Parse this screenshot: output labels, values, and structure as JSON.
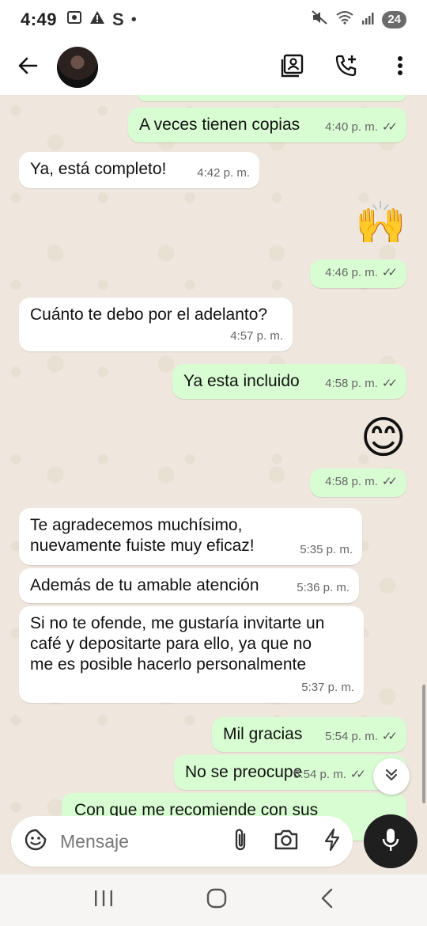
{
  "status_bar": {
    "time": "4:49",
    "dot": "•",
    "battery": "24",
    "icons": [
      "screen-capture-icon",
      "warning-icon",
      "s-app-icon",
      "mute-icon",
      "wifi-icon",
      "signal-icon"
    ]
  },
  "header": {
    "icons": [
      "back-arrow-icon",
      "contact-card-icon",
      "add-call-icon",
      "more-vert-icon"
    ]
  },
  "messages": [
    {
      "id": "m1",
      "direction": "out",
      "text": "A veces tienen copias",
      "time": "4:40 p. m.",
      "ticks": "✓✓"
    },
    {
      "id": "m2",
      "direction": "in",
      "text": "Ya, está completo!",
      "time": "4:42 p. m."
    },
    {
      "id": "m3",
      "direction": "out",
      "emoji": "🙌",
      "time": "4:46 p. m.",
      "ticks": "✓✓"
    },
    {
      "id": "m4",
      "direction": "in",
      "text": "Cuánto te debo por el adelanto?",
      "time": "4:57 p. m."
    },
    {
      "id": "m5",
      "direction": "out",
      "text": "Ya esta incluido",
      "time": "4:58 p. m.",
      "ticks": "✓✓"
    },
    {
      "id": "m6",
      "direction": "out",
      "emoji": "😊",
      "time": "4:58 p. m.",
      "ticks": "✓✓"
    },
    {
      "id": "m7",
      "direction": "in",
      "text": "Te agradecemos muchísimo,\nnuevamente fuiste muy eficaz!",
      "time": "5:35 p. m."
    },
    {
      "id": "m8",
      "direction": "in",
      "text": "Además de tu amable atención",
      "time": "5:36 p. m."
    },
    {
      "id": "m9",
      "direction": "in",
      "text": "Si no te ofende, me gustaría invitarte un\ncafé y depositarte para ello, ya que no\nme es posible hacerlo personalmente",
      "time": "5:37 p. m."
    },
    {
      "id": "m10",
      "direction": "out",
      "text": "Mil gracias",
      "time": "5:54 p. m.",
      "ticks": "✓✓"
    },
    {
      "id": "m11",
      "direction": "out",
      "text": "No se preocupe",
      "time": "5:54 p. m.",
      "ticks": "✓✓"
    },
    {
      "id": "m12",
      "direction": "out",
      "text": "Con que me recomiende con sus"
    }
  ],
  "input": {
    "placeholder": "Mensaje",
    "icons": [
      "sticker-icon",
      "attach-clip-icon",
      "camera-icon",
      "lightning-icon"
    ]
  },
  "nav": {
    "icons": [
      "recent-apps-icon",
      "home-icon",
      "back-nav-icon"
    ]
  },
  "colors": {
    "outgoing_bubble": "#d9fdd3",
    "incoming_bubble": "#ffffff",
    "chat_background": "#efe7dd",
    "mic_button": "#1f1f1f"
  }
}
